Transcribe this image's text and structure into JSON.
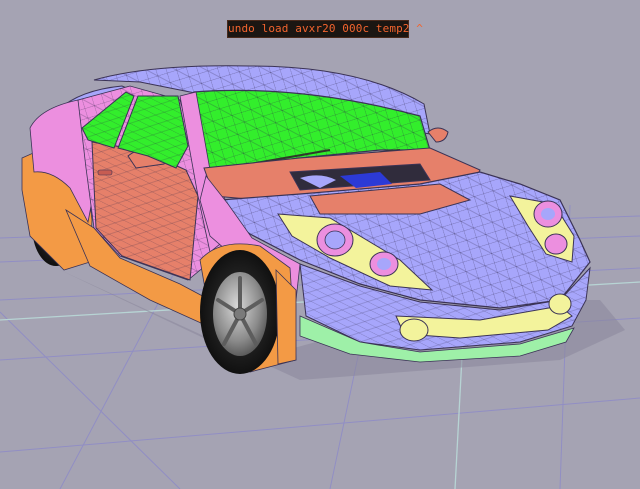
{
  "status_bar": {
    "text": "undo load avxr20 000c temp2 ^"
  },
  "colors": {
    "background": "#a5a3b3",
    "grid_line": "#8f8cc6",
    "grid_axis": "#b7d4d4",
    "body_periwinkle": "#a7a6fb",
    "glass_green": "#33ee2c",
    "fender_salmon": "#e6806a",
    "panel_pink": "#ec8fdf",
    "bumper_orange": "#f39a45",
    "light_yellow": "#f3f39c",
    "sill_green": "#9ef0a8",
    "wire": "#3b3356",
    "status_text": "#f3642e"
  },
  "icons": [
    "wireframe-car-model",
    "ground-grid"
  ]
}
